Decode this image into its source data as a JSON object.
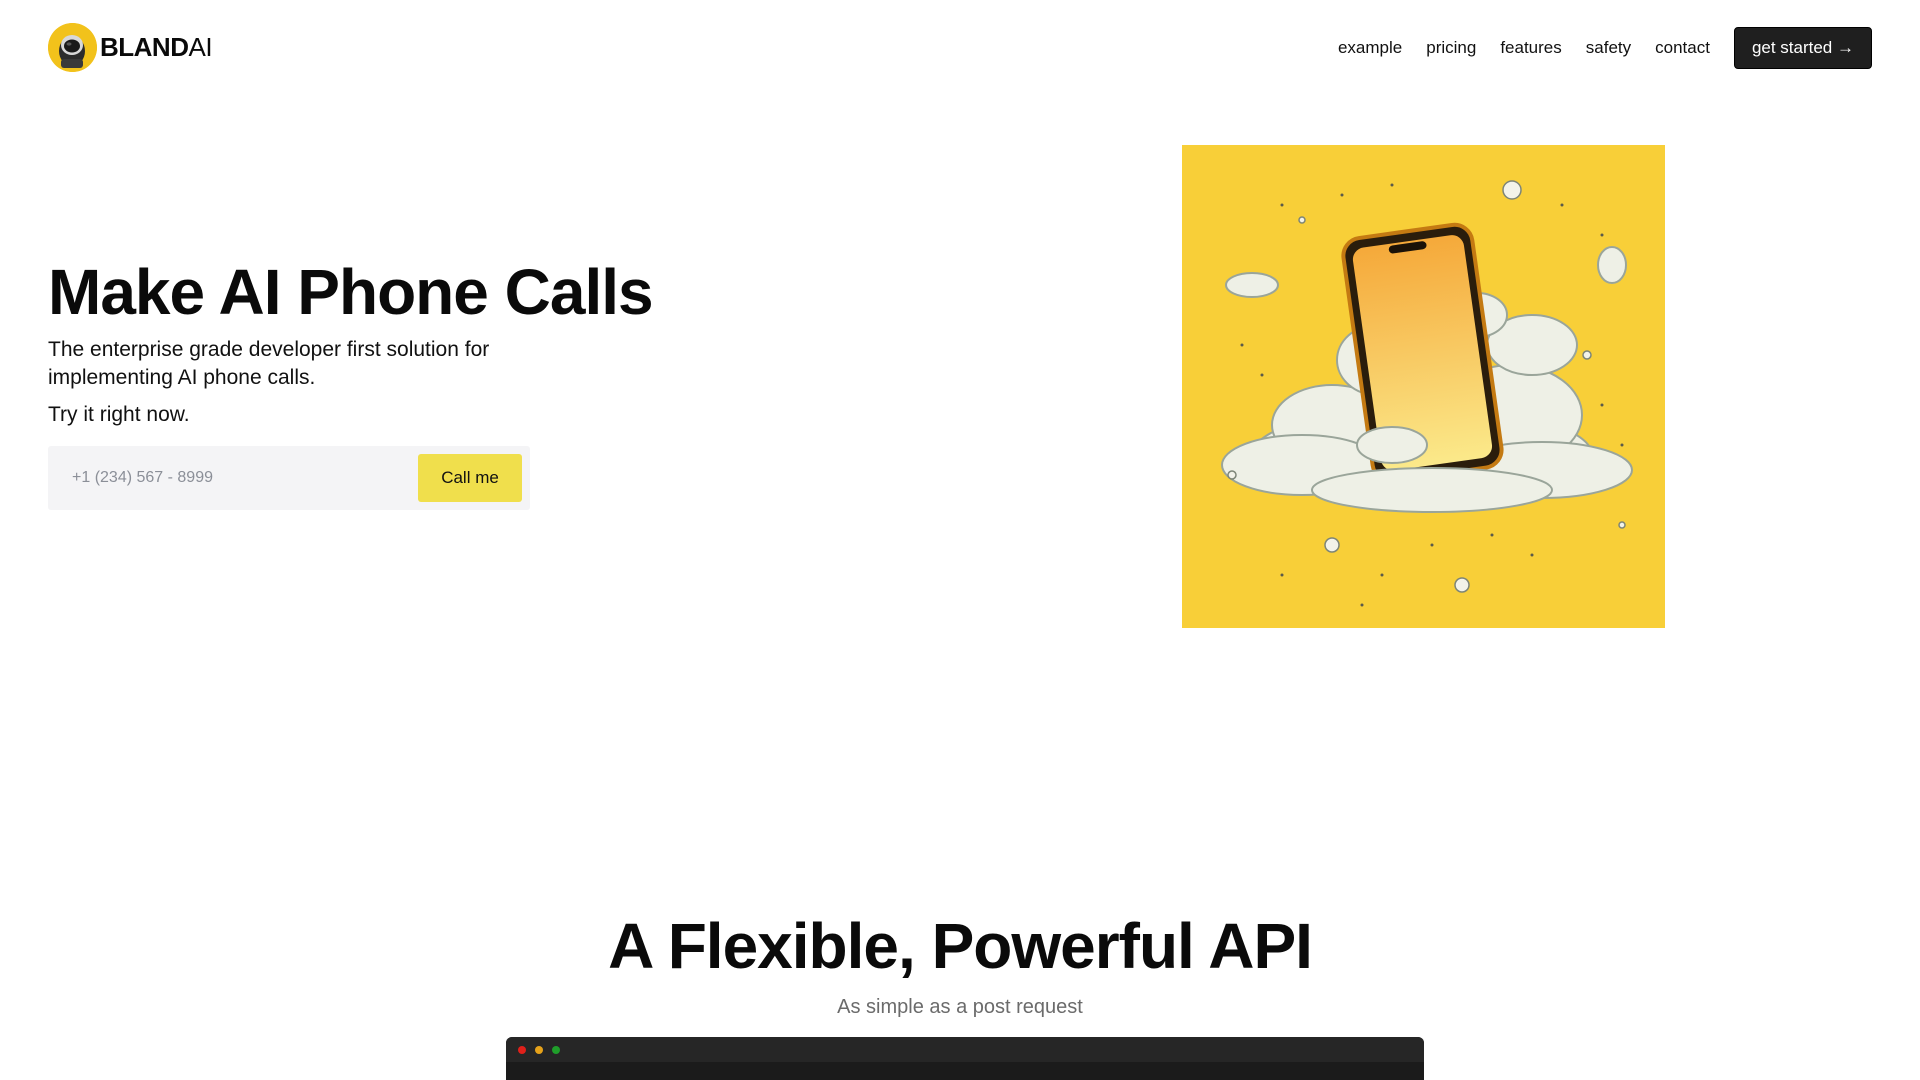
{
  "brand": {
    "name_bold": "BLAND",
    "name_light": "AI"
  },
  "nav": {
    "links": [
      "example",
      "pricing",
      "features",
      "safety",
      "contact"
    ],
    "cta_label": "get started →"
  },
  "hero": {
    "title": "Make AI Phone Calls",
    "subtitle": "The enterprise grade developer first solution for implementing AI phone calls.",
    "try_text": "Try it right now.",
    "phone_placeholder": "+1 (234) 567 - 8999",
    "call_button": "Call me",
    "image_icon": "phone-in-cloud-illustration"
  },
  "api_section": {
    "title": "A Flexible, Powerful API",
    "subtitle": "As simple as a post request"
  },
  "colors": {
    "accent_yellow": "#f0df4c",
    "hero_bg_yellow": "#f8cf38",
    "cta_dark": "#1f1f1f",
    "code_bg": "#1b1b1b"
  }
}
